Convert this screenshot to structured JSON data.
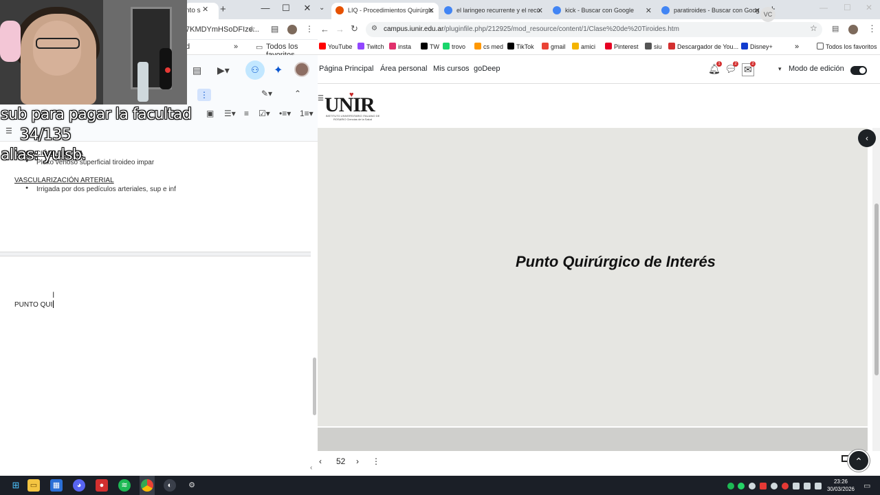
{
  "left_window": {
    "tab_title": "nto s",
    "url_partial": "7KMDYmHSoDFIze...",
    "bookmark_partial": "d",
    "bookmark_all": "Todos los favoritos",
    "doc": {
      "heading_venosa": "ABIGACIÓN VENOSA",
      "item_venosa": "Plexo venoso superficial tiroideo impar",
      "heading_arterial": "VASCULARIZACIÓN ARTERIAL",
      "item_arterial": "Irrigada por dos pedículos arteriales, sup e inf",
      "typing_text": "PUNTO QUI"
    }
  },
  "stream_overlay": {
    "line1": "sub para pagar la facultad",
    "line2": "34/135",
    "line3": "alias: yulsb."
  },
  "right_window": {
    "tabs": [
      {
        "title": "LIQ - Procedimientos Quirúrgic",
        "active": true,
        "color": "#e65100"
      },
      {
        "title": "el laringeo recurrente y el recu",
        "active": false,
        "color": "#4285f4"
      },
      {
        "title": "kick - Buscar con Google",
        "active": false,
        "color": "#4285f4"
      },
      {
        "title": "paratiroides - Buscar con Goog",
        "active": false,
        "color": "#4285f4"
      }
    ],
    "url_host": "campus.iunir.edu.ar",
    "url_path": "/pluginfile.php/212925/mod_resource/content/1/Clase%20de%20Tiroides.htm",
    "bookmarks": [
      {
        "label": "YouTube",
        "color": "#ff0000"
      },
      {
        "label": "Twitch",
        "color": "#9146ff"
      },
      {
        "label": "insta",
        "color": "#e1306c"
      },
      {
        "label": "TW",
        "color": "#000000"
      },
      {
        "label": "trovo",
        "color": "#19d66b"
      },
      {
        "label": "cs med",
        "color": "#ff9800"
      },
      {
        "label": "TikTok",
        "color": "#000000"
      },
      {
        "label": "gmail",
        "color": "#ea4335"
      },
      {
        "label": "amici",
        "color": "#f4b400"
      },
      {
        "label": "Pinterest",
        "color": "#e60023"
      },
      {
        "label": "siu",
        "color": "#555555"
      },
      {
        "label": "Descargador de You...",
        "color": "#d32f2f"
      },
      {
        "label": "Disney+",
        "color": "#113ccf"
      }
    ],
    "bookmark_all": "Todos los favoritos",
    "nav": {
      "home": "Página Principal",
      "personal": "Área personal",
      "courses": "Mis cursos",
      "godeep": "goDeep",
      "notif_count": "1",
      "msg_count": "2",
      "mail_count": "2",
      "avatar_initials": "VC",
      "edit_mode": "Modo de edición"
    },
    "logo": {
      "text": "UNIR",
      "subtitle": "INSTITUTO UNIVERSITARIO ITALIANO DE ROSARIO Ciencias de la Salud"
    },
    "slide_title": "Punto Quirúrgico de Interés",
    "page_number": "52"
  },
  "taskbar": {
    "time": "23:26",
    "date": "30/03/2026"
  }
}
